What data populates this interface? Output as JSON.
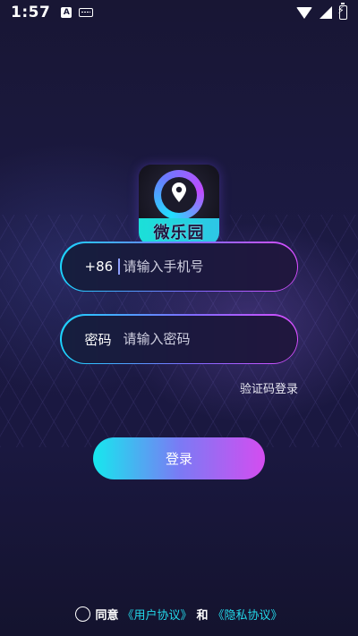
{
  "status_bar": {
    "time": "1:57",
    "notification_badge": "A"
  },
  "logo": {
    "text": "微乐园"
  },
  "phone_field": {
    "prefix": "+86",
    "placeholder": "请输入手机号",
    "value": ""
  },
  "password_field": {
    "label": "密码",
    "placeholder": "请输入密码",
    "value": ""
  },
  "sms_login_label": "验证码登录",
  "login_button_label": "登录",
  "agreement": {
    "agree_text": "同意",
    "user_agreement": "《用户协议》",
    "and_text": "和",
    "privacy_policy": "《隐私协议》"
  }
}
